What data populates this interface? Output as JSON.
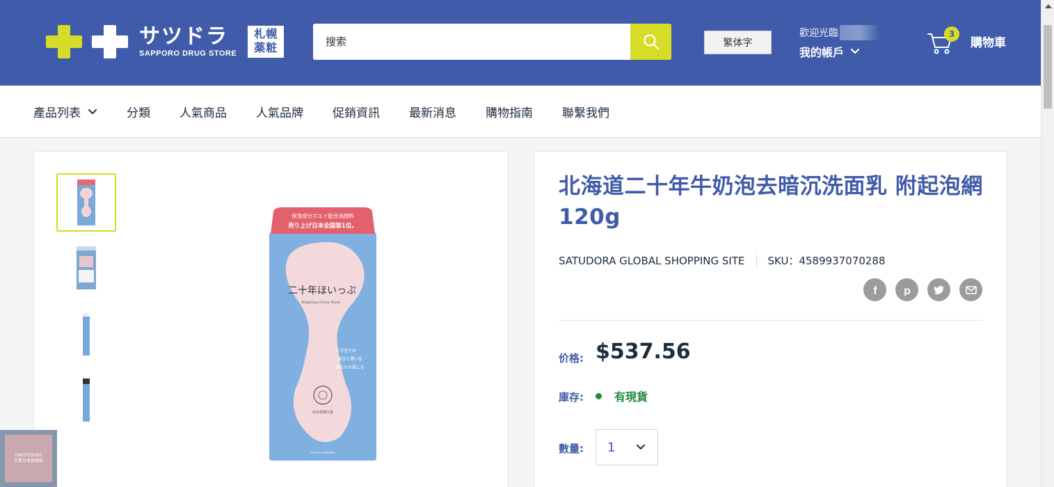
{
  "header": {
    "logo": {
      "jp": "サツドラ",
      "en": "SAPPORO DRUG STORE",
      "box_line1": "札幌",
      "box_line2": "薬粧"
    },
    "search": {
      "placeholder": "搜索",
      "icon": "search-icon"
    },
    "language_button": "繁体字",
    "account": {
      "welcome": "歡迎光臨",
      "label": "我的帳戶"
    },
    "cart": {
      "count": "3",
      "label": "購物車",
      "icon": "cart-icon"
    },
    "colors": {
      "brand_blue": "#3f5ba9",
      "accent_yellow": "#d6dc27",
      "in_stock_green": "#1c8b3c"
    }
  },
  "nav": {
    "items": [
      {
        "label": "產品列表",
        "has_dropdown": true
      },
      {
        "label": "分類"
      },
      {
        "label": "人氣商品"
      },
      {
        "label": "人氣品牌"
      },
      {
        "label": "促銷資訊"
      },
      {
        "label": "最新消息"
      },
      {
        "label": "購物指南"
      },
      {
        "label": "聯繫我們"
      }
    ]
  },
  "product": {
    "title": "北海道二十年牛奶泡去暗沉洗面乳 附起泡網 120g",
    "vendor": "SATUDORA GLOBAL SHOPPING SITE",
    "sku": "SKU：4589937070288",
    "share": [
      "facebook-icon",
      "pinterest-icon",
      "twitter-icon",
      "email-icon"
    ],
    "price_label": "价格:",
    "price": "$537.56",
    "stock_label": "庫存:",
    "stock": "有現貨",
    "quantity_label": "數量:",
    "quantity": "1",
    "image": {
      "banner_line1": "保湿成分ホエイ配合洗顔料",
      "banner_line2": "売り上げ日本全国第1位。",
      "name_jp": "二十年ほいっぷ",
      "name_en": "Brighting Facial Wash",
      "tagline1": "とびきりの",
      "tagline2": "輝きと潤いを",
      "tagline3": "あなたの肌にも",
      "maker": "北の快適工房",
      "made_in": "MADE IN HOKKAIDO"
    }
  },
  "watermark": {
    "line1": "ONLYYUSUKE",
    "line2": "只是日本旅遊誌"
  }
}
